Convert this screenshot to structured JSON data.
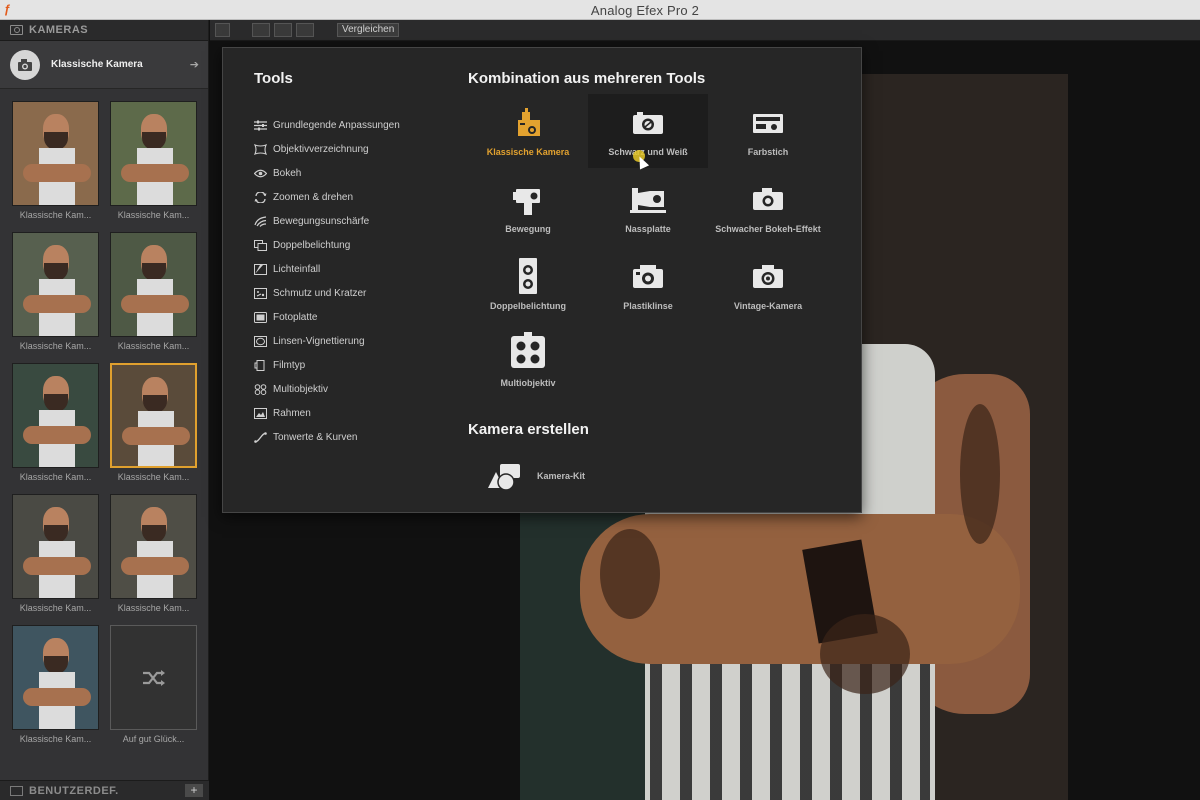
{
  "window": {
    "title": "Analog Efex Pro 2",
    "app_icon": "app-logo-icon"
  },
  "sidebar": {
    "header": "KAMERAS",
    "selected_camera": "Klassische Kamera",
    "thumbnails": [
      {
        "label": "Klassische Kam...",
        "tone": "#8a6a4c"
      },
      {
        "label": "Klassische Kam...",
        "tone": "#5d6a4a"
      },
      {
        "label": "Klassische Kam...",
        "tone": "#57604f"
      },
      {
        "label": "Klassische Kam...",
        "tone": "#4e5945"
      },
      {
        "label": "Klassische Kam...",
        "tone": "#394a40"
      },
      {
        "label": "Klassische Kam...",
        "tone": "#5a4b3a"
      },
      {
        "label": "Klassische Kam...",
        "tone": "#4a4a44"
      },
      {
        "label": "Klassische Kam...",
        "tone": "#4f4e46"
      },
      {
        "label": "Klassische Kam...",
        "tone": "#3f5560"
      },
      {
        "label": "Auf gut Glück..."
      }
    ],
    "footer": "BENUTZERDEF."
  },
  "toolbar": {
    "compare_label": "Vergleichen"
  },
  "panel": {
    "tools_title": "Tools",
    "tools": [
      {
        "label": "Grundlegende Anpassungen",
        "icon": "sliders-icon"
      },
      {
        "label": "Objektivverzeichnung",
        "icon": "lens-distortion-icon"
      },
      {
        "label": "Bokeh",
        "icon": "bokeh-eye-icon"
      },
      {
        "label": "Zoomen & drehen",
        "icon": "rotate-icon"
      },
      {
        "label": "Bewegungsunschärfe",
        "icon": "motion-blur-icon"
      },
      {
        "label": "Doppelbelichtung",
        "icon": "double-exposure-icon"
      },
      {
        "label": "Lichteinfall",
        "icon": "light-leak-icon"
      },
      {
        "label": "Schmutz und Kratzer",
        "icon": "dirt-icon"
      },
      {
        "label": "Fotoplatte",
        "icon": "photo-plate-icon"
      },
      {
        "label": "Linsen-Vignettierung",
        "icon": "vignette-icon"
      },
      {
        "label": "Filmtyp",
        "icon": "film-type-icon"
      },
      {
        "label": "Multiobjektiv",
        "icon": "multi-lens-icon"
      },
      {
        "label": "Rahmen",
        "icon": "frame-icon"
      },
      {
        "label": "Tonwerte & Kurven",
        "icon": "curves-icon"
      }
    ],
    "combo_title": "Kombination aus mehreren Tools",
    "cameras": [
      {
        "label": "Klassische Kamera",
        "icon": "classic-camera-icon",
        "active": true
      },
      {
        "label": "Schwarz und Weiß",
        "icon": "bw-camera-icon"
      },
      {
        "label": "Farbstich",
        "icon": "color-cast-camera-icon"
      },
      {
        "label": "Bewegung",
        "icon": "movie-camera-icon"
      },
      {
        "label": "Nassplatte",
        "icon": "wet-plate-camera-icon"
      },
      {
        "label": "Schwacher Bokeh-Effekt",
        "icon": "subtle-bokeh-camera-icon"
      },
      {
        "label": "Doppelbelichtung",
        "icon": "twin-lens-camera-icon"
      },
      {
        "label": "Plastiklinse",
        "icon": "toy-camera-icon"
      },
      {
        "label": "Vintage-Kamera",
        "icon": "vintage-camera-icon"
      },
      {
        "label": "Multiobjektiv",
        "icon": "multi-lens-camera-icon"
      }
    ],
    "create_title": "Kamera erstellen",
    "kit_label": "Kamera-Kit"
  },
  "colors": {
    "accent": "#e3a22f",
    "panel_bg": "#262626",
    "sidebar_bg": "#333335"
  }
}
